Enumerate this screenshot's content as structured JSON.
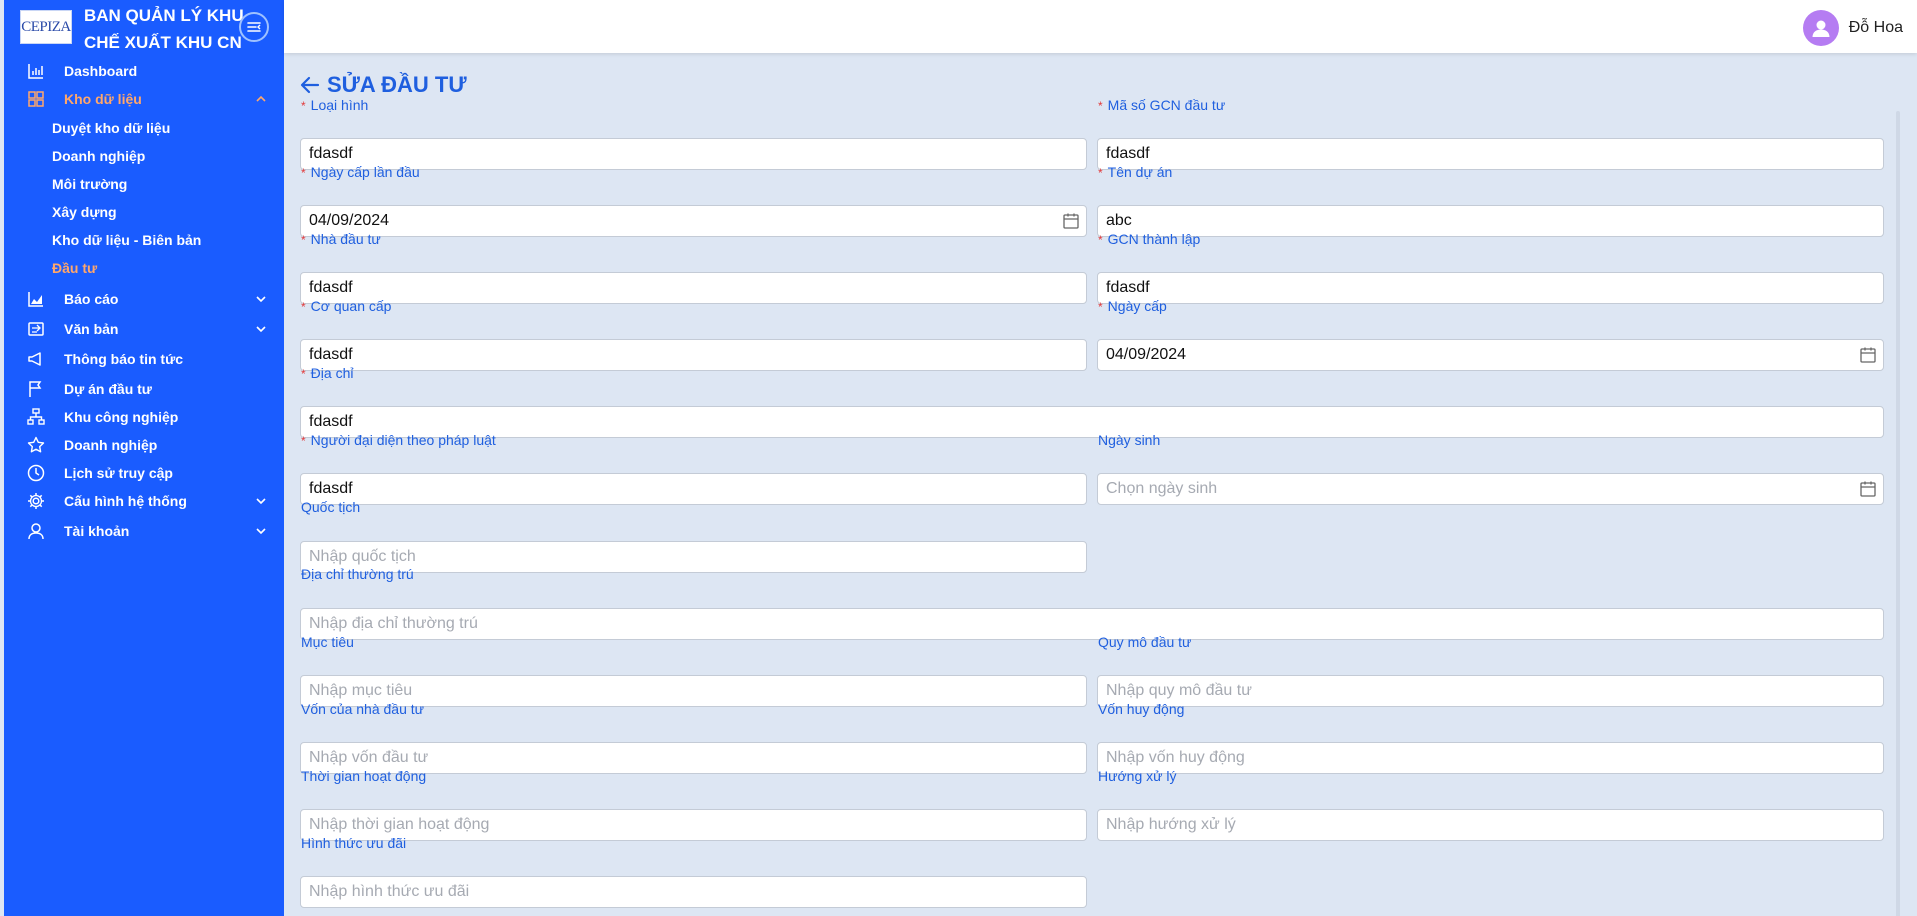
{
  "brand": {
    "logo_text": "CEPIZA",
    "title": "BAN QUẢN LÝ KHU CHẾ XUẤT KHU CN"
  },
  "sidebar": {
    "items": [
      {
        "label": "Dashboard"
      },
      {
        "label": "Kho dữ liệu",
        "expanded": true
      },
      {
        "label": "Báo cáo"
      },
      {
        "label": "Văn bản"
      },
      {
        "label": "Thông báo tin tức"
      },
      {
        "label": "Dự án đầu tư"
      },
      {
        "label": "Khu công nghiệp"
      },
      {
        "label": "Doanh nghiệp"
      },
      {
        "label": "Lịch sử truy cập"
      },
      {
        "label": "Cấu hình hệ thống"
      },
      {
        "label": "Tài khoản"
      }
    ],
    "subitems": [
      {
        "label": "Duyệt kho dữ liệu"
      },
      {
        "label": "Doanh nghiệp"
      },
      {
        "label": "Môi trường"
      },
      {
        "label": "Xây dựng"
      },
      {
        "label": "Kho dữ liệu - Biên bản"
      },
      {
        "label": "Đầu tư",
        "active": true
      }
    ]
  },
  "header": {
    "user_name": "Đỗ Hoa"
  },
  "page": {
    "title": "SỬA ĐẦU TƯ"
  },
  "form": {
    "loai_hinh": {
      "label": "Loại hình",
      "value": "fdasdf",
      "required": true
    },
    "ma_so_gcn": {
      "label": "Mã số GCN đầu tư",
      "value": "fdasdf",
      "required": true
    },
    "ngay_cap_lan_dau": {
      "label": "Ngày cấp lần đầu",
      "value": "04/09/2024",
      "required": true
    },
    "ten_du_an": {
      "label": "Tên dự án",
      "value": "abc",
      "required": true
    },
    "nha_dau_tu": {
      "label": "Nhà đầu tư",
      "value": "fdasdf",
      "required": true
    },
    "gcn_thanh_lap": {
      "label": "GCN thành lập",
      "value": "fdasdf",
      "required": true
    },
    "co_quan_cap": {
      "label": "Cơ quan cấp",
      "value": "fdasdf",
      "required": true
    },
    "ngay_cap": {
      "label": "Ngày cấp",
      "value": "04/09/2024",
      "required": true
    },
    "dia_chi": {
      "label": "Địa chỉ",
      "value": "fdasdf",
      "required": true
    },
    "nguoi_dai_dien": {
      "label": "Người đại diện theo pháp luật",
      "value": "fdasdf",
      "required": true
    },
    "ngay_sinh": {
      "label": "Ngày sinh",
      "placeholder": "Chọn ngày sinh"
    },
    "quoc_tich": {
      "label": "Quốc tịch",
      "placeholder": "Nhập quốc tịch"
    },
    "dia_chi_thuong_tru": {
      "label": "Địa chỉ thường trú",
      "placeholder": "Nhập địa chỉ thường trú"
    },
    "muc_tieu": {
      "label": "Mục tiêu",
      "placeholder": "Nhập mục tiêu"
    },
    "quy_mo_dau_tu": {
      "label": "Quy mô đầu tư",
      "placeholder": "Nhập quy mô đầu tư"
    },
    "von_nha_dau_tu": {
      "label": "Vốn của nhà đầu tư",
      "placeholder": "Nhập vốn đầu tư"
    },
    "von_huy_dong": {
      "label": "Vốn huy động",
      "placeholder": "Nhập vốn huy động"
    },
    "thoi_gian_hoat_dong": {
      "label": "Thời gian hoạt động",
      "placeholder": "Nhập thời gian hoạt động"
    },
    "huong_xu_ly": {
      "label": "Hướng xử lý",
      "placeholder": "Nhập hướng xử lý"
    },
    "hinh_thuc_uu_dai": {
      "label": "Hình thức ưu đãi",
      "placeholder": "Nhập hình thức ưu đãi"
    }
  },
  "colors": {
    "sidebar_bg": "#1a5cff",
    "active_menu": "#ffa76b",
    "label_blue": "#1f5fdf",
    "required": "#e23b3b",
    "avatar": "#b57cf2"
  }
}
